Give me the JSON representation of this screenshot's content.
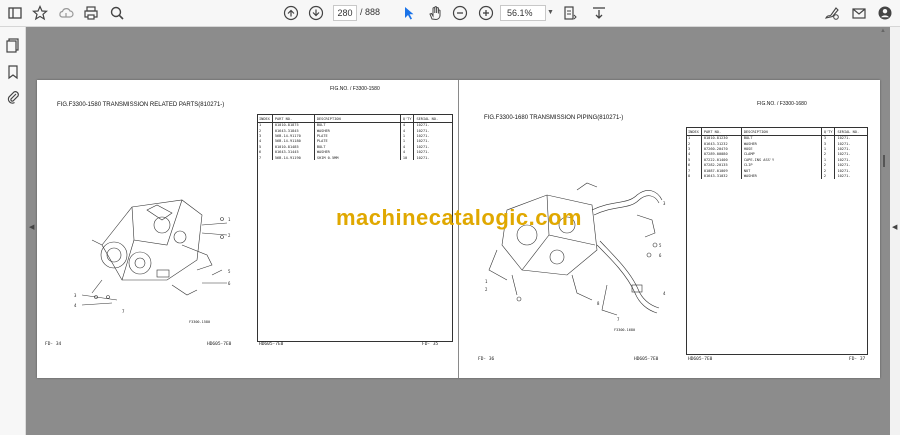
{
  "toolbar": {
    "current_page": "280",
    "total_pages": "/ 888",
    "zoom": "56.1%"
  },
  "colors": {
    "toolbar_bg": "#f7f7f7",
    "viewer_bg": "#8c8c8c",
    "watermark": "#e0a800",
    "cursor_accent": "#1a73e8"
  },
  "icons": {
    "toolbar": [
      "star-icon",
      "cloud-upload-icon",
      "print-icon",
      "search-icon",
      "page-up-icon",
      "page-down-icon",
      "select-cursor-icon",
      "hand-tool-icon",
      "zoom-out-icon",
      "zoom-in-icon",
      "fit-page-icon",
      "scroll-mode-icon",
      "sign-icon",
      "mail-icon",
      "account-icon"
    ],
    "sidebar": [
      "pages-icon",
      "bookmark-icon",
      "attachment-icon"
    ]
  },
  "left_page": {
    "fig_header": "FIG.NO. / F3300-1580",
    "title": "FIG.F3300-1580  TRANSMISSION RELATED PARTS(810271-)",
    "columns": [
      "INDEX",
      "PART NO.",
      "DESCRIPTION",
      "Q'TY",
      "SERIAL NO."
    ],
    "rows": [
      [
        "1",
        "01010-81875",
        "BOLT",
        "4",
        "10271-"
      ],
      [
        "2",
        "01643-31845",
        "WASHER",
        "4",
        "10271-"
      ],
      [
        "3",
        "56B-14-91170",
        "PLATE",
        "1",
        "10271-"
      ],
      [
        "4",
        "56B-14-91180",
        "PLATE",
        "1",
        "10271-"
      ],
      [
        "5",
        "01010-81485",
        "BOLT",
        "4",
        "10271-"
      ],
      [
        "6",
        "01643-31445",
        "WASHER",
        "4",
        "10271-"
      ],
      [
        "7",
        "56B-14-91190",
        "SHIM  0.5MM",
        "10",
        "10271-"
      ]
    ],
    "footer_left": "FD- 34",
    "footer_mid": "HD605-7E0",
    "footer_code": "HD605-7E0",
    "footer_right": "FD- 35",
    "drawing_code": "F3300-1580"
  },
  "right_page": {
    "fig_header": "FIG.NO. / F3300-1680",
    "title": "FIG.F3300-1680  TRANSMISSION PIPING(810271-)",
    "columns": [
      "INDEX",
      "PART NO.",
      "DESCRIPTION",
      "Q'TY",
      "SERIAL NO."
    ],
    "rows": [
      [
        "1",
        "01010-81230",
        "BOLT",
        "3",
        "10271-"
      ],
      [
        "2",
        "01643-31232",
        "WASHER",
        "3",
        "10271-"
      ],
      [
        "3",
        "07260-20470",
        "HOSE",
        "1",
        "10271-"
      ],
      [
        "4",
        "07289-00080",
        "CLAMP",
        "2",
        "10271-"
      ],
      [
        "5",
        "07222-01400",
        "CAPE-INS ASS'Y",
        "1",
        "10271-"
      ],
      [
        "6",
        "07282-20135",
        "CLIP",
        "2",
        "10271-"
      ],
      [
        "7",
        "01087-01009",
        "NUT",
        "2",
        "10271-"
      ],
      [
        "8",
        "01643-31032",
        "WASHER",
        "2",
        "10271-"
      ]
    ],
    "footer_left": "FD- 36",
    "footer_mid": "HD605-7E0",
    "footer_code": "HD605-7E0",
    "footer_right": "FD- 37",
    "drawing_code": "F3300-1680"
  },
  "watermark": "machinecatalogic.com"
}
